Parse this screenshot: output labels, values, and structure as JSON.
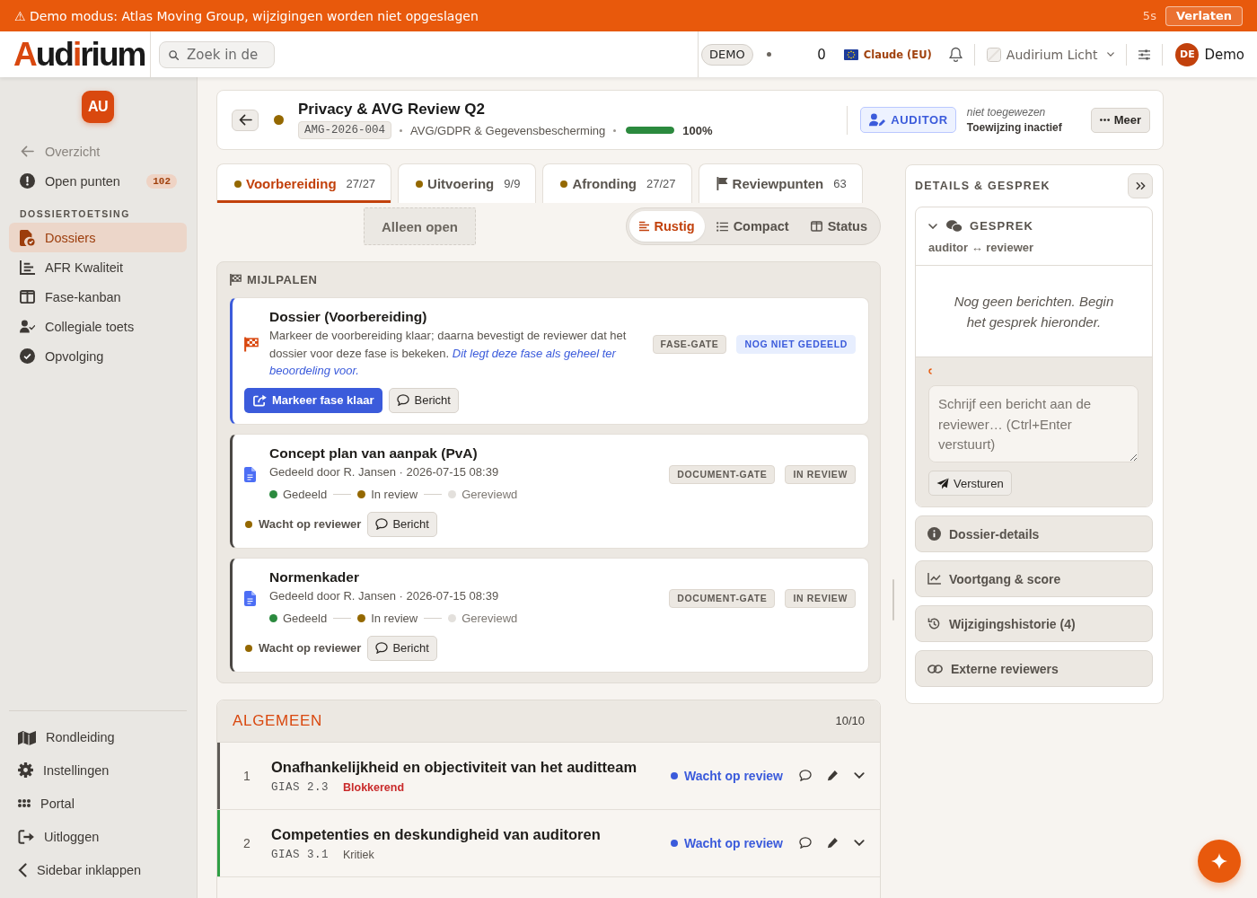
{
  "banner": {
    "text": "⚠ Demo modus: Atlas Moving Group, wijzigingen worden niet opgeslagen",
    "countdown": "5s",
    "button": "Verlaten"
  },
  "header": {
    "logo": [
      {
        "text": "A",
        "accent": true
      },
      {
        "text": "ud",
        "accent": false
      },
      {
        "text": "i",
        "accent": true
      },
      {
        "text": "rium",
        "accent": false
      }
    ],
    "search": {
      "placeholder": "Zoek in de"
    },
    "mode_badge": "DEMO",
    "counter": "0",
    "ai_model": "Claude (EU)",
    "theme": "Audirium Licht",
    "user": {
      "initials": "DE",
      "name": "Demo"
    }
  },
  "sidebar": {
    "workspace": "AU",
    "top_items": [
      {
        "kind": "back",
        "label": "Overzicht"
      },
      {
        "kind": "link",
        "label": "Open punten",
        "count": "102"
      }
    ],
    "section": "DOSSIERTOETSING",
    "items": [
      {
        "label": "Dossiers",
        "selected": true
      },
      {
        "label": "AFR Kwaliteit",
        "selected": false
      },
      {
        "label": "Fase-kanban",
        "selected": false
      },
      {
        "label": "Collegiale toets",
        "selected": false
      },
      {
        "label": "Opvolging",
        "selected": false
      }
    ],
    "footer_items": [
      "Rondleiding",
      "Instellingen",
      "Portal",
      "Uitloggen",
      "Sidebar inklappen"
    ]
  },
  "dossier": {
    "title": "Privacy & AVG Review Q2",
    "code": "AMG-2026-004",
    "category": "AVG/GDPR & Gegevensbescherming",
    "progress": {
      "level": 1.0,
      "reading": "100%"
    },
    "role_button": "AUDITOR",
    "assignee": "niet toegewezen",
    "assignment_status": "Toewijzing inactief",
    "more_button": "Meer"
  },
  "tabs": [
    {
      "kind": "phase",
      "label": "Voorbereiding",
      "count": "27/27",
      "selected": true
    },
    {
      "kind": "phase",
      "label": "Uitvoering",
      "count": "9/9",
      "selected": false
    },
    {
      "kind": "phase",
      "label": "Afronding",
      "count": "27/27",
      "selected": false
    },
    {
      "kind": "points",
      "label": "Reviewpunten",
      "count": "63",
      "selected": false
    }
  ],
  "filter_button": "Alleen open",
  "view_modes": [
    {
      "label": "Rustig",
      "selected": true
    },
    {
      "label": "Compact",
      "selected": false
    },
    {
      "label": "Status",
      "selected": false
    }
  ],
  "milestones": {
    "title": "MIJLPALEN",
    "items": [
      {
        "kind": "phase_gate",
        "title": "Dossier (Voorbereiding)",
        "description": "Markeer de voorbereiding klaar; daarna bevestigt de reviewer dat het dossier voor deze fase is bekeken. *Dit legt deze fase als geheel ter beoordeling voor.*",
        "tags": [
          {
            "kind": "neutral",
            "label": "FASE-GATE"
          },
          {
            "kind": "info",
            "label": "NOG NIET GEDEELD"
          }
        ],
        "primary_action": "Markeer fase klaar",
        "message_button": "Bericht"
      },
      {
        "kind": "document_gate",
        "title": "Concept plan van aanpak (PvA)",
        "meta": "Gedeeld door R. Jansen · 2026-07-15 08:39",
        "steps": [
          {
            "label": "Gedeeld",
            "kind": "done"
          },
          {
            "label": "In review",
            "kind": "current"
          },
          {
            "label": "Gereviewd",
            "kind": "todo"
          }
        ],
        "tags": [
          {
            "kind": "neutral",
            "label": "DOCUMENT-GATE"
          },
          {
            "kind": "neutral",
            "label": "IN REVIEW"
          }
        ],
        "waiting": "Wacht op reviewer",
        "message_button": "Bericht"
      },
      {
        "kind": "document_gate",
        "title": "Normenkader",
        "meta": "Gedeeld door R. Jansen · 2026-07-15 08:39",
        "steps": [
          {
            "label": "Gedeeld",
            "kind": "done"
          },
          {
            "label": "In review",
            "kind": "current"
          },
          {
            "label": "Gereviewd",
            "kind": "todo"
          }
        ],
        "tags": [
          {
            "kind": "neutral",
            "label": "DOCUMENT-GATE"
          },
          {
            "kind": "neutral",
            "label": "IN REVIEW"
          }
        ],
        "waiting": "Wacht op reviewer",
        "message_button": "Bericht"
      }
    ]
  },
  "section": {
    "title": "ALGEMEEN",
    "count": "10/10",
    "rows": [
      {
        "number": "1",
        "title": "Onafhankelijkheid en objectiviteit van het auditteam",
        "code": "GIAS 2.3",
        "severity": "Blokkerend",
        "kind": "blocking",
        "color": "#5f5b57",
        "status": "Wacht op review"
      },
      {
        "number": "2",
        "title": "Competenties en deskundigheid van auditoren",
        "code": "GIAS 3.1",
        "severity": "Kritiek",
        "kind": "critical",
        "color": "#2f9e44",
        "status": "Wacht op review"
      }
    ]
  },
  "panel": {
    "title": "DETAILS & GESPREK",
    "conversation": {
      "title": "GESPREK",
      "expanded": true,
      "subtitle": "auditor ↔ reviewer",
      "empty": "Nog geen berichten. Begin het gesprek hieronder.",
      "input": {
        "placeholder": "Schrijf een bericht aan de reviewer… (Ctrl+Enter verstuurt)"
      },
      "send": "Versturen"
    },
    "sections": [
      "Dossier-details",
      "Voortgang & score",
      "Wijzigingshistorie (4)",
      "Externe reviewers"
    ]
  }
}
